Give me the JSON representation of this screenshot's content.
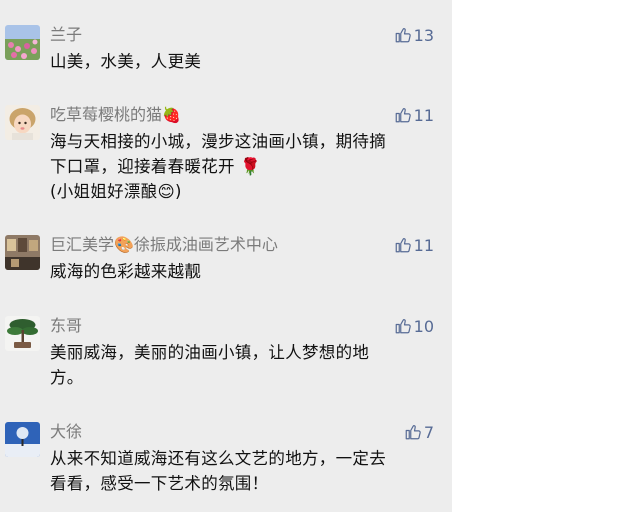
{
  "comments": [
    {
      "author": "兰子",
      "likes": "13",
      "lines": [
        "山美，水美，人更美"
      ]
    },
    {
      "author": "吃草莓樱桃的猫",
      "author_emoji": "🍓",
      "likes": "11",
      "lines": [
        "海与天相接的小城，漫步这油画小镇，期待摘",
        "下口罩，迎接着春暖花开 🌹",
        "(小姐姐好漂酿😊)"
      ]
    },
    {
      "author": "巨汇美学🎨徐振成油画艺术中心",
      "likes": "11",
      "lines": [
        "威海的色彩越来越靓"
      ]
    },
    {
      "author": "东哥",
      "likes": "10",
      "lines": [
        "美丽威海，美丽的油画小镇，让人梦想的地",
        "方。"
      ]
    },
    {
      "author": "大徐",
      "likes": "7",
      "lines": [
        "从来不知道威海还有这么文艺的地方，一定去",
        "看看，感受一下艺术的氛围！"
      ]
    }
  ],
  "icons": {
    "like": "thumbs-up-icon"
  },
  "colors": {
    "panel_bg": "#ededed",
    "name": "#7b7b7b",
    "like": "#576b95",
    "text": "#111111"
  }
}
